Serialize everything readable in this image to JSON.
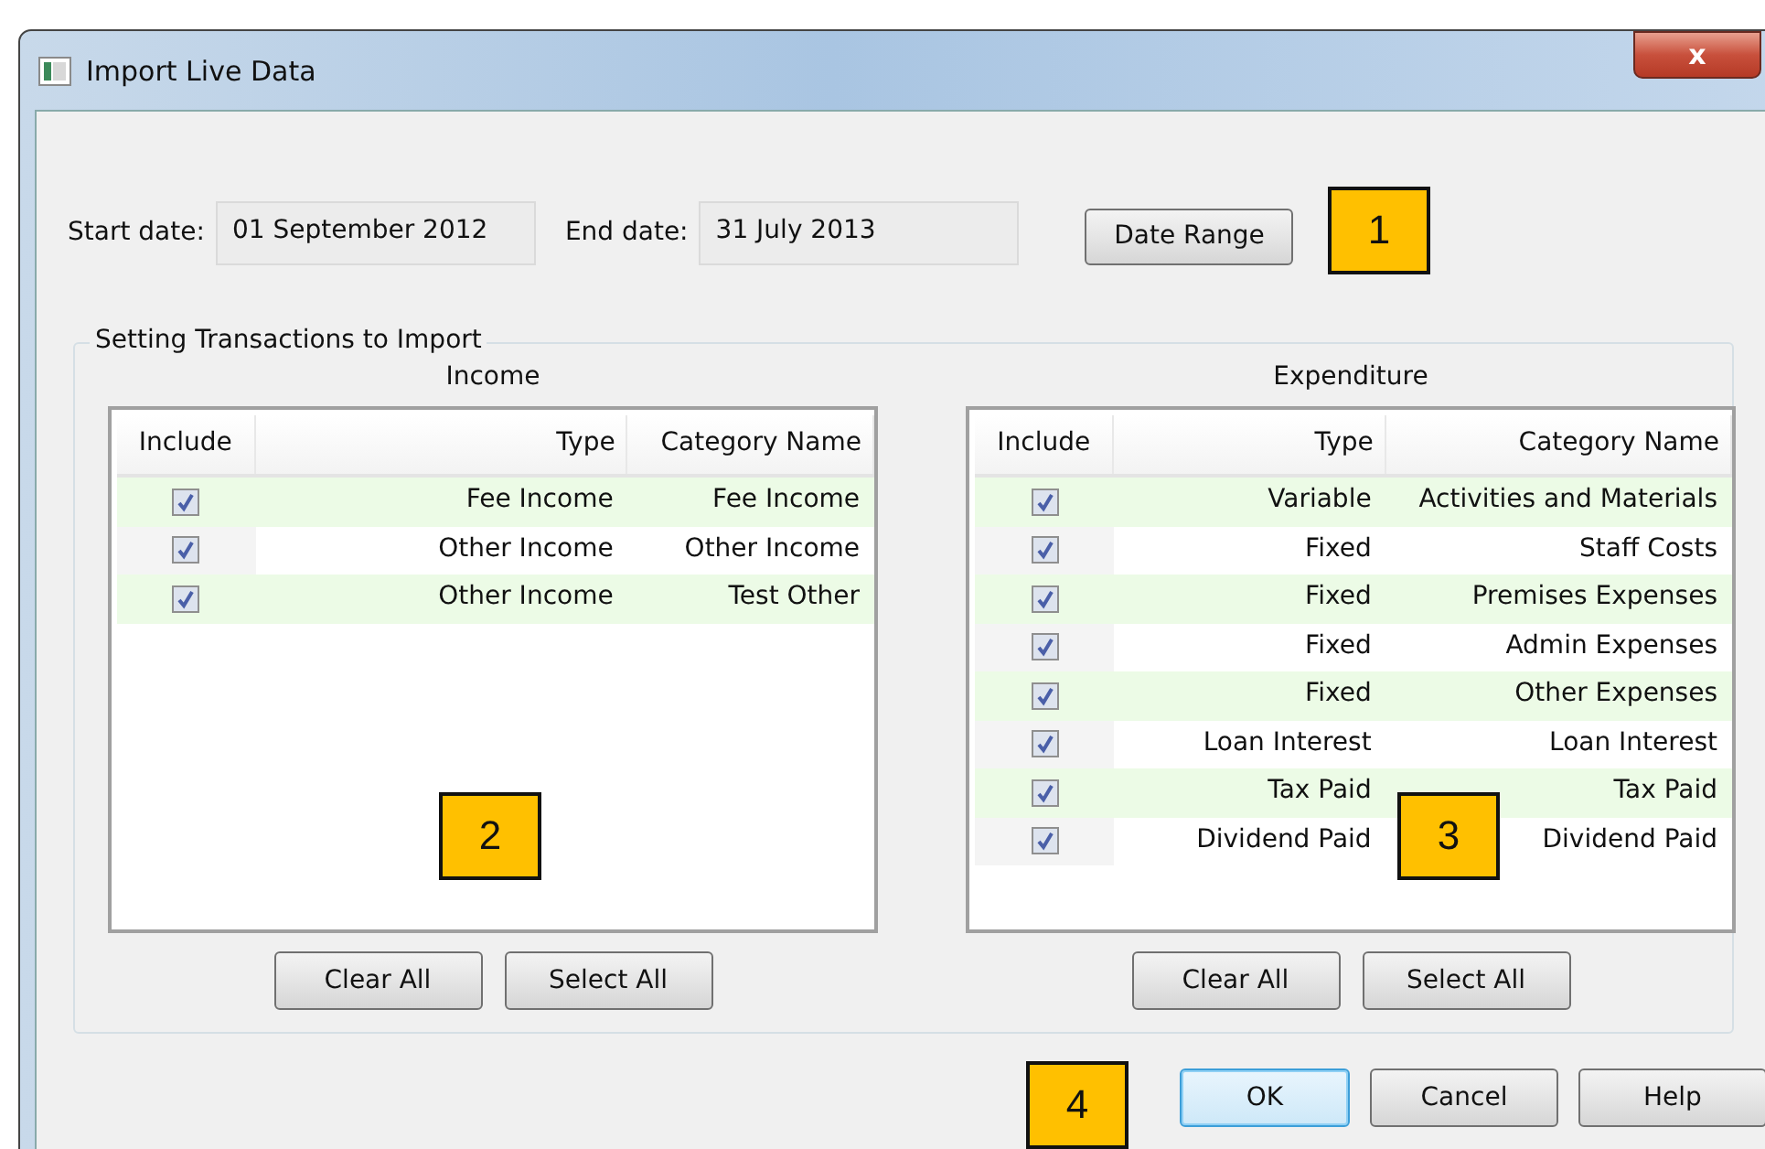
{
  "window": {
    "title": "Import Live Data",
    "close": "x"
  },
  "dates": [
    {
      "label": "Start date:",
      "value": "01 September 2012"
    },
    {
      "label": "End date:",
      "value": "31 July 2013"
    }
  ],
  "date_range_button": "Date Range",
  "group": {
    "title": "Setting Transactions to Import"
  },
  "panels": [
    {
      "title": "Income",
      "columns": [
        "Include",
        "Type",
        "Category Name"
      ],
      "rows": [
        {
          "checked": true,
          "type": "Fee Income",
          "category": "Fee Income"
        },
        {
          "checked": true,
          "type": "Other Income",
          "category": "Other Income"
        },
        {
          "checked": true,
          "type": "Other Income",
          "category": "Test Other"
        }
      ],
      "buttons": [
        "Clear All",
        "Select All"
      ]
    },
    {
      "title": "Expenditure",
      "columns": [
        "Include",
        "Type",
        "Category Name"
      ],
      "rows": [
        {
          "checked": true,
          "type": "Variable",
          "category": "Activities and Materials"
        },
        {
          "checked": true,
          "type": "Fixed",
          "category": "Staff Costs"
        },
        {
          "checked": true,
          "type": "Fixed",
          "category": "Premises Expenses"
        },
        {
          "checked": true,
          "type": "Fixed",
          "category": "Admin Expenses"
        },
        {
          "checked": true,
          "type": "Fixed",
          "category": "Other Expenses"
        },
        {
          "checked": true,
          "type": "Loan Interest",
          "category": "Loan Interest"
        },
        {
          "checked": true,
          "type": "Tax Paid",
          "category": "Tax Paid"
        },
        {
          "checked": true,
          "type": "Dividend Paid",
          "category": "Dividend Paid"
        }
      ],
      "buttons": [
        "Clear All",
        "Select All"
      ]
    }
  ],
  "dialog_buttons": [
    {
      "label": "OK",
      "selected": true
    },
    {
      "label": "Cancel",
      "selected": false
    },
    {
      "label": "Help",
      "selected": false
    }
  ],
  "callouts": [
    "1",
    "2",
    "3",
    "4"
  ]
}
